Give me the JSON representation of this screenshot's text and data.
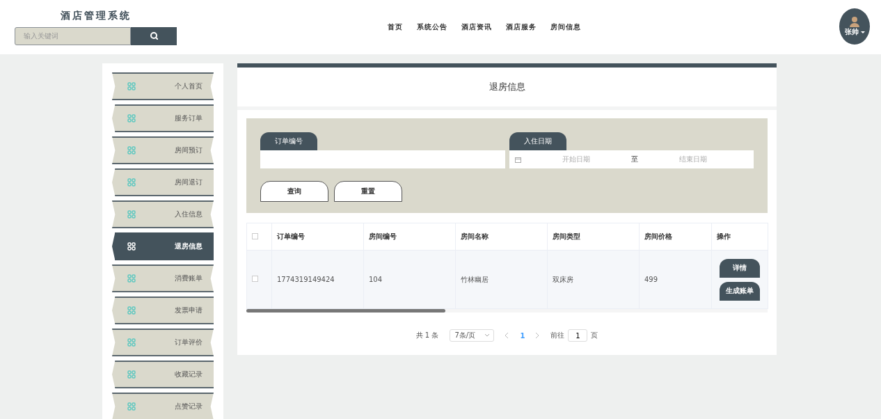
{
  "header": {
    "title": "酒店管理系统",
    "search": {
      "placeholder": "输入关键词"
    },
    "nav": [
      {
        "label": "首页"
      },
      {
        "label": "系统公告"
      },
      {
        "label": "酒店资讯"
      },
      {
        "label": "酒店服务"
      },
      {
        "label": "房间信息"
      }
    ],
    "user": {
      "name": "张帅"
    }
  },
  "sidebar": {
    "items": [
      {
        "label": "个人首页",
        "selected": false
      },
      {
        "label": "服务订单",
        "selected": false
      },
      {
        "label": "房间预订",
        "selected": false
      },
      {
        "label": "房间退订",
        "selected": false
      },
      {
        "label": "入住信息",
        "selected": false
      },
      {
        "label": "退房信息",
        "selected": true
      },
      {
        "label": "消费账单",
        "selected": false
      },
      {
        "label": "发票申请",
        "selected": false
      },
      {
        "label": "订单评价",
        "selected": false
      },
      {
        "label": "收藏记录",
        "selected": false
      },
      {
        "label": "点赞记录",
        "selected": false
      }
    ]
  },
  "panel": {
    "title": "退房信息",
    "filters": [
      {
        "kind": "text",
        "label": "订单编号"
      },
      {
        "kind": "daterange",
        "label": "入住日期",
        "start_placeholder": "开始日期",
        "separator": "至",
        "end_placeholder": "结束日期"
      }
    ],
    "buttons": [
      "查询",
      "重置"
    ],
    "table": {
      "header_checked": false,
      "columns": [
        "订单编号",
        "房间编号",
        "房间名称",
        "房间类型",
        "房间价格",
        "操作"
      ],
      "rows": [
        {
          "checked": false,
          "cells": [
            "1774319149424",
            "104",
            "竹林幽居",
            "双床房",
            "499"
          ],
          "actions": [
            "详情",
            "生成账单"
          ]
        }
      ]
    },
    "pagination": {
      "total": "共 1 条",
      "page_size": "7条/页",
      "pages": [
        {
          "label": "1",
          "selected": true
        }
      ],
      "goto_label": "前往",
      "goto_value": "1",
      "goto_suffix": "页"
    }
  }
}
